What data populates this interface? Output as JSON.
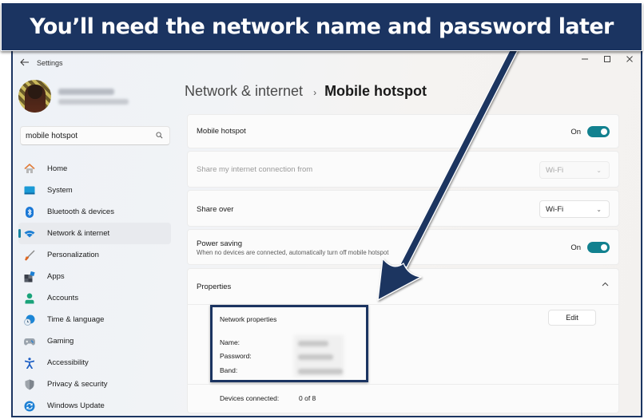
{
  "annotation": {
    "banner_text": "You’ll need the network name and password later",
    "color": "#1b3461"
  },
  "window": {
    "title": "Settings",
    "controls": {
      "minimize": "–",
      "maximize": "☐",
      "close": "✕"
    }
  },
  "profile": {
    "name": "[blurred]",
    "email": "[blurred]"
  },
  "search": {
    "value": "mobile hotspot",
    "icon": "search-icon"
  },
  "sidebar": {
    "items": [
      {
        "label": "Home",
        "icon": "home-icon",
        "active": false
      },
      {
        "label": "System",
        "icon": "system-icon",
        "active": false
      },
      {
        "label": "Bluetooth & devices",
        "icon": "bluetooth-icon",
        "active": false
      },
      {
        "label": "Network & internet",
        "icon": "wifi-icon",
        "active": true
      },
      {
        "label": "Personalization",
        "icon": "brush-icon",
        "active": false
      },
      {
        "label": "Apps",
        "icon": "apps-icon",
        "active": false
      },
      {
        "label": "Accounts",
        "icon": "person-icon",
        "active": false
      },
      {
        "label": "Time & language",
        "icon": "clock-globe-icon",
        "active": false
      },
      {
        "label": "Gaming",
        "icon": "gamepad-icon",
        "active": false
      },
      {
        "label": "Accessibility",
        "icon": "accessibility-icon",
        "active": false
      },
      {
        "label": "Privacy & security",
        "icon": "shield-icon",
        "active": false
      },
      {
        "label": "Windows Update",
        "icon": "update-icon",
        "active": false
      }
    ]
  },
  "breadcrumb": {
    "parent": "Network & internet",
    "separator": "›",
    "current": "Mobile hotspot"
  },
  "settings": {
    "mobile_hotspot": {
      "label": "Mobile hotspot",
      "state": "On",
      "enabled": true
    },
    "share_from": {
      "label": "Share my internet connection from",
      "value": "Wi-Fi",
      "disabled": true
    },
    "share_over": {
      "label": "Share over",
      "value": "Wi-Fi"
    },
    "power_saving": {
      "label": "Power saving",
      "description": "When no devices are connected, automatically turn off mobile hotspot",
      "state": "On",
      "enabled": true
    },
    "properties": {
      "label": "Properties",
      "expanded": true,
      "section_title": "Network properties",
      "edit_label": "Edit",
      "fields": [
        {
          "label": "Name:",
          "value": "[blurred]"
        },
        {
          "label": "Password:",
          "value": "[blurred]"
        },
        {
          "label": "Band:",
          "value": "[blurred]"
        }
      ],
      "devices_label": "Devices connected:",
      "devices_value": "0 of 8"
    }
  },
  "colors": {
    "accent": "#12818f",
    "annotation_navy": "#1b3461",
    "active_indicator": "#1683a0"
  }
}
